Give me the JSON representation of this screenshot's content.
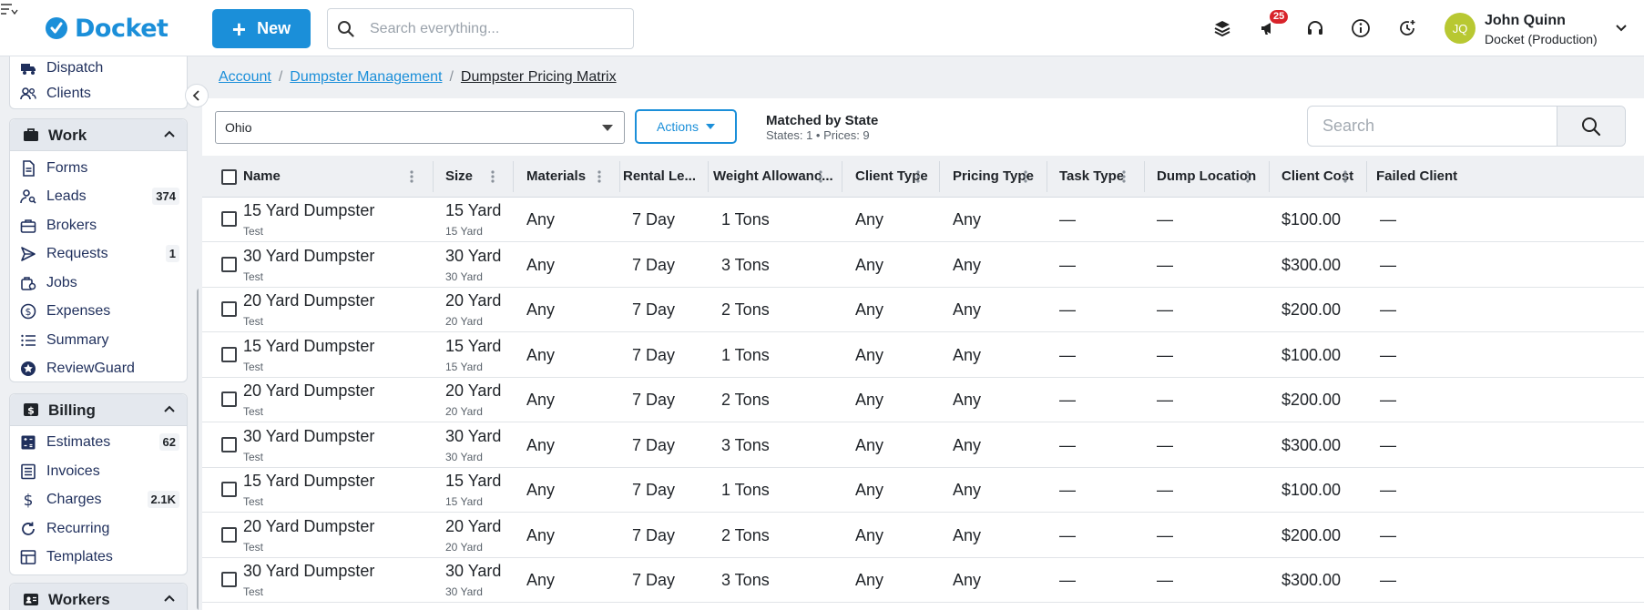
{
  "app": {
    "logo_text": "Docket",
    "new_label": "New",
    "search_placeholder": "Search everything...",
    "notification_count": "25",
    "user_initials": "JQ",
    "user_name": "John Quinn",
    "user_org": "Docket (Production)",
    "accent": "#1b8fd9"
  },
  "sidebar": {
    "top_items": [
      {
        "label": "Dispatch",
        "icon": "truck-icon"
      },
      {
        "label": "Clients",
        "icon": "users-icon"
      }
    ],
    "work": {
      "title": "Work",
      "items": [
        {
          "label": "Forms",
          "icon": "document-icon",
          "count": ""
        },
        {
          "label": "Leads",
          "icon": "user-search-icon",
          "count": "374"
        },
        {
          "label": "Brokers",
          "icon": "briefcase-icon",
          "count": ""
        },
        {
          "label": "Requests",
          "icon": "send-icon",
          "count": "1"
        },
        {
          "label": "Jobs",
          "icon": "jobs-icon",
          "count": ""
        },
        {
          "label": "Expenses",
          "icon": "dollar-circle-icon",
          "count": ""
        },
        {
          "label": "Summary",
          "icon": "list-icon",
          "count": ""
        },
        {
          "label": "ReviewGuard",
          "icon": "star-badge-icon",
          "count": ""
        }
      ]
    },
    "billing": {
      "title": "Billing",
      "items": [
        {
          "label": "Estimates",
          "icon": "estimate-icon",
          "count": "62"
        },
        {
          "label": "Invoices",
          "icon": "invoice-icon",
          "count": ""
        },
        {
          "label": "Charges",
          "icon": "dollar-icon",
          "count": "2.1K"
        },
        {
          "label": "Recurring",
          "icon": "refresh-icon",
          "count": ""
        },
        {
          "label": "Templates",
          "icon": "template-icon",
          "count": ""
        }
      ]
    },
    "workers": {
      "title": "Workers"
    }
  },
  "breadcrumb": {
    "items": [
      "Account",
      "Dumpster Management"
    ],
    "current": "Dumpster Pricing Matrix"
  },
  "toolbar": {
    "state_value": "Ohio",
    "actions_label": "Actions",
    "match_title": "Matched by State",
    "match_sub": "States: 1 • Prices: 9",
    "search_placeholder": "Search"
  },
  "table": {
    "columns": [
      "Name",
      "Size",
      "Materials",
      "Rental Le...",
      "Weight Allowanc...",
      "Client Type",
      "Pricing Type",
      "Task Type",
      "Dump Location",
      "Client Cost",
      "Failed Client"
    ],
    "rows": [
      {
        "name": "15 Yard Dumpster",
        "name_sub": "Test",
        "size": "15 Yard",
        "size_sub": "15 Yard",
        "materials": "Any",
        "rental": "7 Day",
        "weight": "1 Tons",
        "client_type": "Any",
        "pricing_type": "Any",
        "task_type": "—",
        "dump_location": "—",
        "client_cost": "$100.00",
        "failed": "—"
      },
      {
        "name": "30 Yard Dumpster",
        "name_sub": "Test",
        "size": "30 Yard",
        "size_sub": "30 Yard",
        "materials": "Any",
        "rental": "7 Day",
        "weight": "3 Tons",
        "client_type": "Any",
        "pricing_type": "Any",
        "task_type": "—",
        "dump_location": "—",
        "client_cost": "$300.00",
        "failed": "—"
      },
      {
        "name": "20 Yard Dumpster",
        "name_sub": "Test",
        "size": "20 Yard",
        "size_sub": "20 Yard",
        "materials": "Any",
        "rental": "7 Day",
        "weight": "2 Tons",
        "client_type": "Any",
        "pricing_type": "Any",
        "task_type": "—",
        "dump_location": "—",
        "client_cost": "$200.00",
        "failed": "—"
      },
      {
        "name": "15 Yard Dumpster",
        "name_sub": "Test",
        "size": "15 Yard",
        "size_sub": "15 Yard",
        "materials": "Any",
        "rental": "7 Day",
        "weight": "1 Tons",
        "client_type": "Any",
        "pricing_type": "Any",
        "task_type": "—",
        "dump_location": "—",
        "client_cost": "$100.00",
        "failed": "—"
      },
      {
        "name": "20 Yard Dumpster",
        "name_sub": "Test",
        "size": "20 Yard",
        "size_sub": "20 Yard",
        "materials": "Any",
        "rental": "7 Day",
        "weight": "2 Tons",
        "client_type": "Any",
        "pricing_type": "Any",
        "task_type": "—",
        "dump_location": "—",
        "client_cost": "$200.00",
        "failed": "—"
      },
      {
        "name": "30 Yard Dumpster",
        "name_sub": "Test",
        "size": "30 Yard",
        "size_sub": "30 Yard",
        "materials": "Any",
        "rental": "7 Day",
        "weight": "3 Tons",
        "client_type": "Any",
        "pricing_type": "Any",
        "task_type": "—",
        "dump_location": "—",
        "client_cost": "$300.00",
        "failed": "—"
      },
      {
        "name": "15 Yard Dumpster",
        "name_sub": "Test",
        "size": "15 Yard",
        "size_sub": "15 Yard",
        "materials": "Any",
        "rental": "7 Day",
        "weight": "1 Tons",
        "client_type": "Any",
        "pricing_type": "Any",
        "task_type": "—",
        "dump_location": "—",
        "client_cost": "$100.00",
        "failed": "—"
      },
      {
        "name": "20 Yard Dumpster",
        "name_sub": "Test",
        "size": "20 Yard",
        "size_sub": "20 Yard",
        "materials": "Any",
        "rental": "7 Day",
        "weight": "2 Tons",
        "client_type": "Any",
        "pricing_type": "Any",
        "task_type": "—",
        "dump_location": "—",
        "client_cost": "$200.00",
        "failed": "—"
      },
      {
        "name": "30 Yard Dumpster",
        "name_sub": "Test",
        "size": "30 Yard",
        "size_sub": "30 Yard",
        "materials": "Any",
        "rental": "7 Day",
        "weight": "3 Tons",
        "client_type": "Any",
        "pricing_type": "Any",
        "task_type": "—",
        "dump_location": "—",
        "client_cost": "$300.00",
        "failed": "—"
      }
    ]
  }
}
